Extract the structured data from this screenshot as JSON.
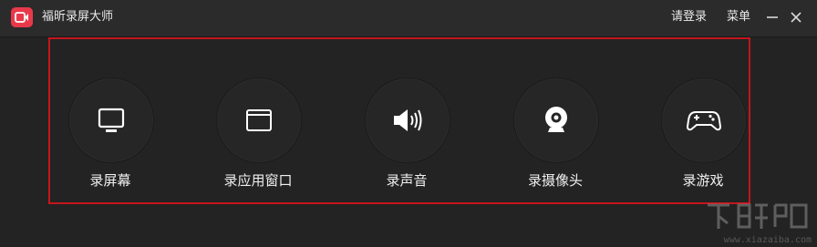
{
  "titlebar": {
    "app_title": "福昕录屏大师",
    "login_label": "请登录",
    "menu_label": "菜单",
    "minimize_icon": "minimize-icon",
    "close_icon": "close-icon"
  },
  "actions": [
    {
      "label": "录屏幕",
      "icon": "monitor-icon"
    },
    {
      "label": "录应用窗口",
      "icon": "window-icon"
    },
    {
      "label": "录声音",
      "icon": "speaker-icon"
    },
    {
      "label": "录摄像头",
      "icon": "webcam-icon"
    },
    {
      "label": "录游戏",
      "icon": "gamepad-icon"
    }
  ],
  "colors": {
    "brand": "#e8394a",
    "highlight": "#c4161c",
    "background": "#232323"
  },
  "watermark": {
    "text": "www.xiazaiba.com"
  }
}
